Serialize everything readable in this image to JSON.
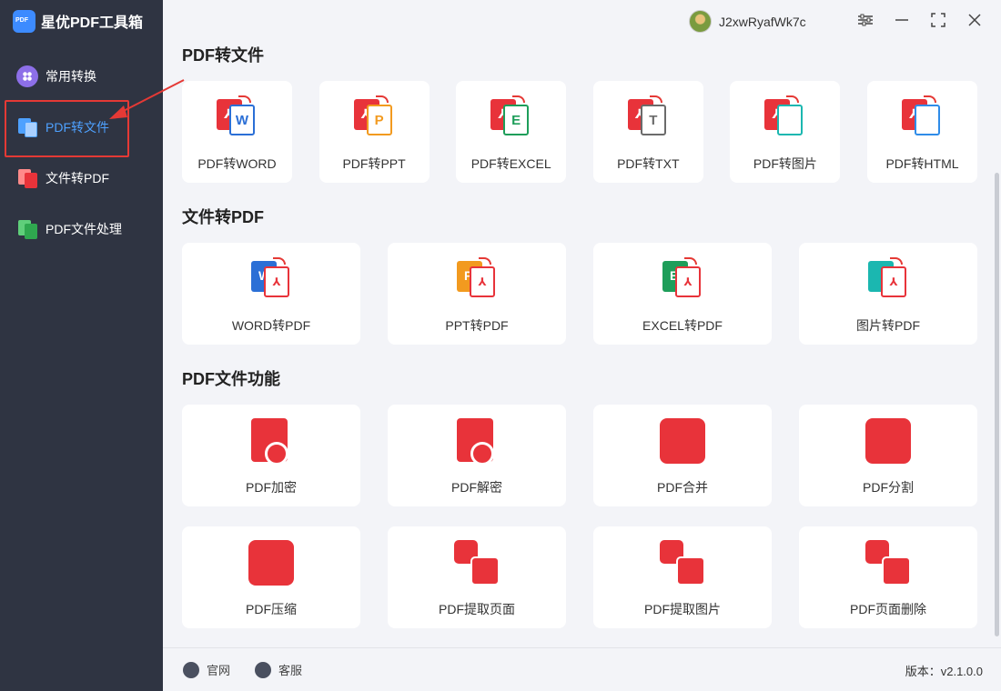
{
  "app": {
    "name": "星优PDF工具箱"
  },
  "sidebar": {
    "items": [
      {
        "label": "常用转换"
      },
      {
        "label": "PDF转文件"
      },
      {
        "label": "文件转PDF"
      },
      {
        "label": "PDF文件处理"
      }
    ]
  },
  "user": {
    "name": "J2xwRyafWk7c"
  },
  "sections": {
    "pdf_to_file": {
      "title": "PDF转文件",
      "items": [
        {
          "label": "PDF转WORD",
          "icon": "pdf-to-word-icon",
          "color": "#2b6fd6",
          "glyph": "W"
        },
        {
          "label": "PDF转PPT",
          "icon": "pdf-to-ppt-icon",
          "color": "#f29a1f",
          "glyph": "P"
        },
        {
          "label": "PDF转EXCEL",
          "icon": "pdf-to-excel-icon",
          "color": "#1e9e5a",
          "glyph": "E"
        },
        {
          "label": "PDF转TXT",
          "icon": "pdf-to-txt-icon",
          "color": "#6b6b6b",
          "glyph": "T"
        },
        {
          "label": "PDF转图片",
          "icon": "pdf-to-image-icon",
          "color": "#1bb7b0",
          "glyph": ""
        },
        {
          "label": "PDF转HTML",
          "icon": "pdf-to-html-icon",
          "color": "#2f8ce8",
          "glyph": "</>"
        }
      ]
    },
    "file_to_pdf": {
      "title": "文件转PDF",
      "items": [
        {
          "label": "WORD转PDF",
          "icon": "word-to-pdf-icon",
          "color": "#2b6fd6",
          "glyph": "W"
        },
        {
          "label": "PPT转PDF",
          "icon": "ppt-to-pdf-icon",
          "color": "#f29a1f",
          "glyph": "P"
        },
        {
          "label": "EXCEL转PDF",
          "icon": "excel-to-pdf-icon",
          "color": "#1e9e5a",
          "glyph": "E"
        },
        {
          "label": "图片转PDF",
          "icon": "image-to-pdf-icon",
          "color": "#1bb7b0",
          "glyph": ""
        }
      ]
    },
    "pdf_functions": {
      "title": "PDF文件功能",
      "items": [
        {
          "label": "PDF加密",
          "icon": "pdf-encrypt-icon"
        },
        {
          "label": "PDF解密",
          "icon": "pdf-decrypt-icon"
        },
        {
          "label": "PDF合并",
          "icon": "pdf-merge-icon"
        },
        {
          "label": "PDF分割",
          "icon": "pdf-split-icon"
        },
        {
          "label": "PDF压缩",
          "icon": "pdf-compress-icon"
        },
        {
          "label": "PDF提取页面",
          "icon": "pdf-extract-pages-icon"
        },
        {
          "label": "PDF提取图片",
          "icon": "pdf-extract-images-icon"
        },
        {
          "label": "PDF页面删除",
          "icon": "pdf-delete-pages-icon"
        }
      ]
    }
  },
  "footer": {
    "website": "官网",
    "support": "客服",
    "version_label": "版本：",
    "version": "v2.1.0.0"
  },
  "colors": {
    "accent": "#e8333a",
    "sidebar_bg": "#2f3442",
    "active": "#4ea1ff"
  }
}
